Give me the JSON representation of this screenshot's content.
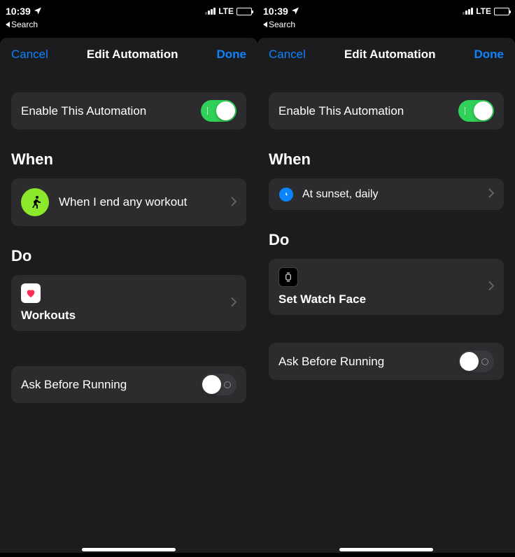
{
  "status": {
    "time": "10:39",
    "network": "LTE",
    "back_app": "Search"
  },
  "nav": {
    "cancel": "Cancel",
    "title": "Edit Automation",
    "done": "Done"
  },
  "left_screen": {
    "enable_label": "Enable This Automation",
    "enable_on": true,
    "when_title": "When",
    "when_text": "When I end any workout",
    "do_title": "Do",
    "do_text": "Workouts",
    "ask_label": "Ask Before Running",
    "ask_on": false
  },
  "right_screen": {
    "enable_label": "Enable This Automation",
    "enable_on": true,
    "when_title": "When",
    "when_text": "At sunset, daily",
    "do_title": "Do",
    "do_text": "Set Watch Face",
    "ask_label": "Ask Before Running",
    "ask_on": false
  }
}
